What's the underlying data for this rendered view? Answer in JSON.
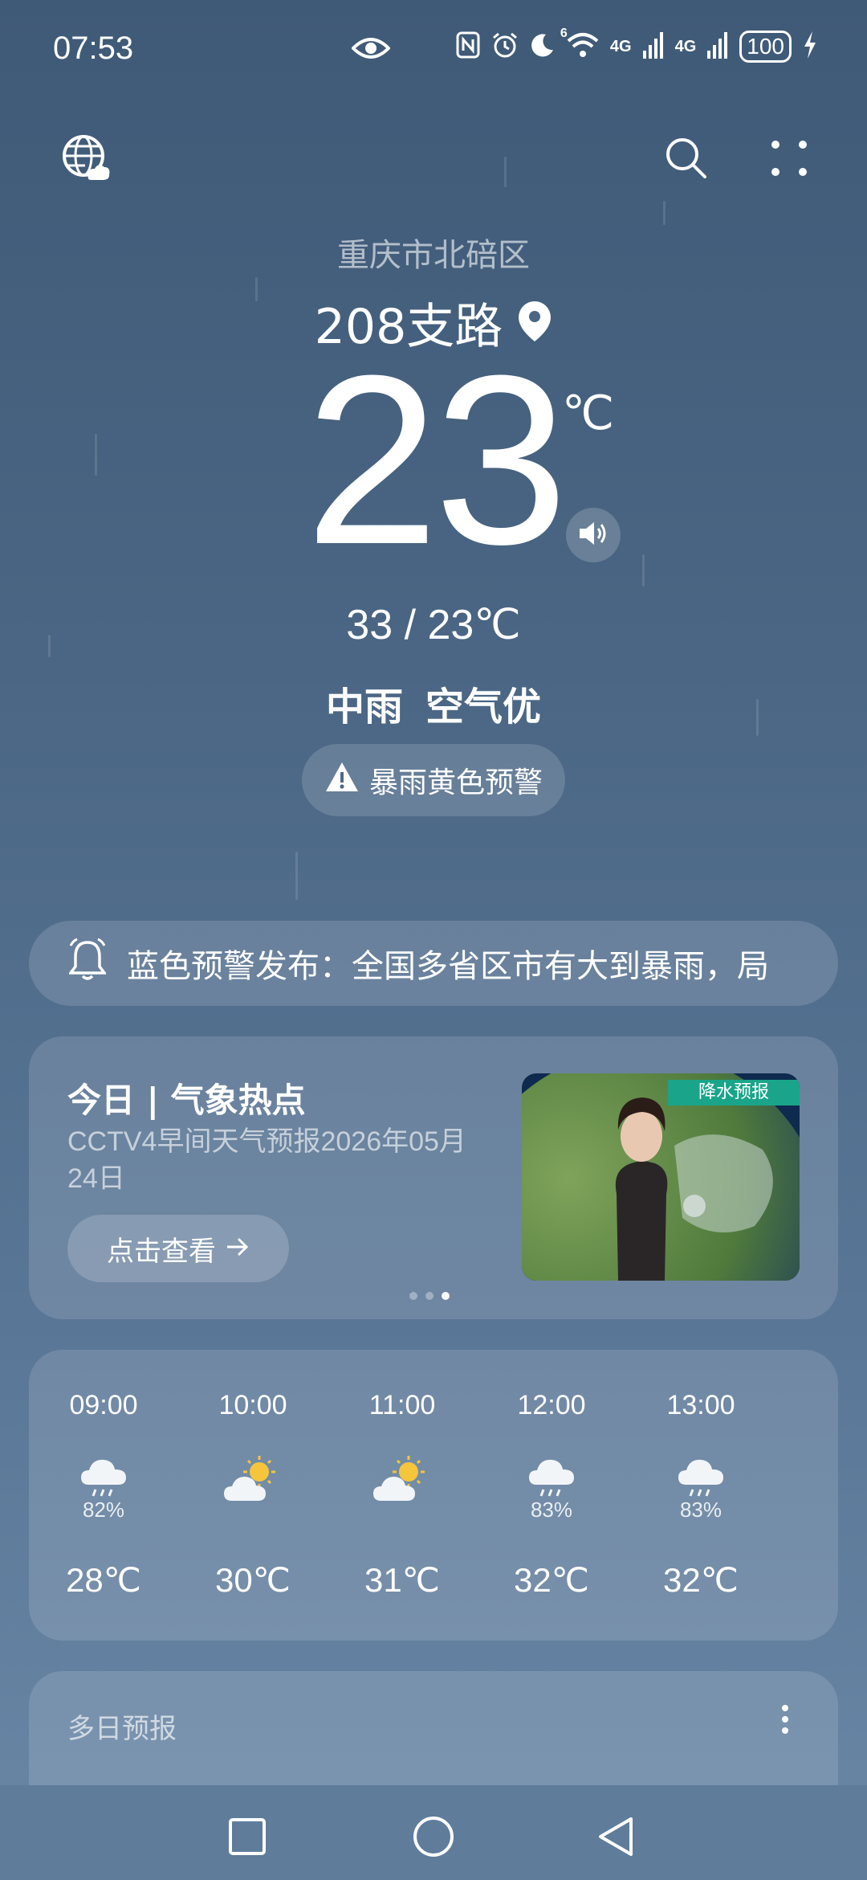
{
  "status_bar": {
    "time": "07:53",
    "signal_1": "4G",
    "signal_2": "4G",
    "wifi_sup": "6",
    "battery": "100"
  },
  "location": {
    "district": "重庆市北碚区",
    "street": "208支路"
  },
  "current": {
    "temp": "23",
    "unit": "℃",
    "range": "33 / 23℃",
    "condition": "中雨",
    "air": "空气优",
    "alert": "暴雨黄色预警"
  },
  "notice": {
    "text": "蓝色预警发布：全国多省区市有大到暴雨，局"
  },
  "hot": {
    "title": "今日 | 气象热点",
    "subtitle": "CCTV4早间天气预报2026年05月24日",
    "button": "点击查看",
    "thumb_tag": "降水预报"
  },
  "hourly": [
    {
      "time": "09:00",
      "icon": "rain-cloud-icon",
      "pct": "82%",
      "temp": "28℃"
    },
    {
      "time": "10:00",
      "icon": "sun-cloud-icon",
      "pct": "",
      "temp": "30℃"
    },
    {
      "time": "11:00",
      "icon": "sun-cloud-icon",
      "pct": "",
      "temp": "31℃"
    },
    {
      "time": "12:00",
      "icon": "rain-cloud-icon",
      "pct": "83%",
      "temp": "32℃"
    },
    {
      "time": "13:00",
      "icon": "rain-cloud-icon",
      "pct": "83%",
      "temp": "32℃"
    }
  ],
  "multiday": {
    "title": "多日预报"
  },
  "colors": {
    "bg_top": "#3f5a77",
    "bg_bottom": "#6a87a6",
    "sun": "#f5c53c",
    "thumb_tag": "#1aa58a"
  }
}
